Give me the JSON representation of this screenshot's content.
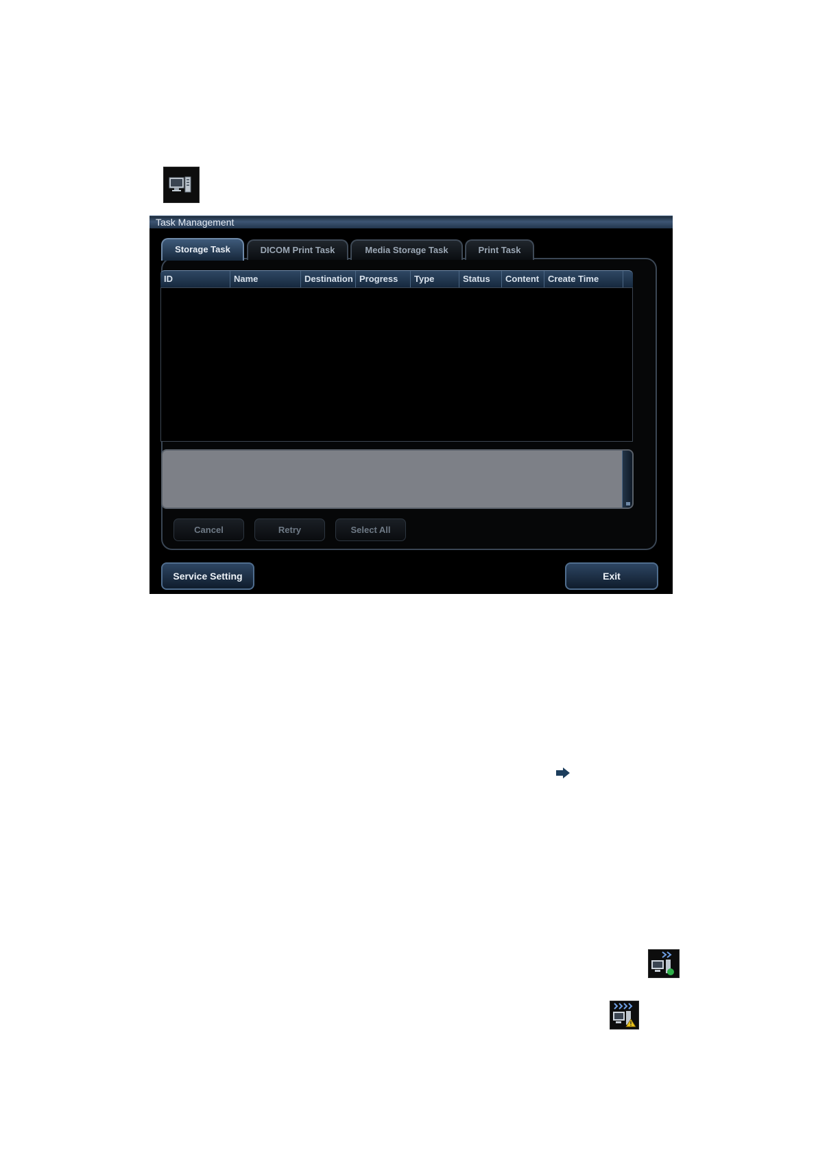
{
  "header_icon": {
    "name": "monitor-server-icon"
  },
  "window": {
    "title": "Task Management",
    "tabs": [
      {
        "label": "Storage Task",
        "active": true
      },
      {
        "label": "DICOM Print Task",
        "active": false
      },
      {
        "label": "Media Storage Task",
        "active": false
      },
      {
        "label": "Print Task",
        "active": false
      }
    ],
    "table": {
      "columns": [
        "ID",
        "Name",
        "Destination",
        "Progress",
        "Type",
        "Status",
        "Content",
        "Create Time"
      ],
      "rows": []
    },
    "message_box": {
      "value": ""
    },
    "buttons": {
      "cancel": "Cancel",
      "retry": "Retry",
      "select_all": "Select All",
      "service_setting": "Service Setting",
      "exit": "Exit"
    }
  },
  "arrow_marker": {
    "name": "right-arrow-icon",
    "color": "#1c3d5c"
  },
  "status_icons": [
    {
      "name": "network-sending-icon"
    },
    {
      "name": "network-warning-icon"
    }
  ],
  "colors": {
    "accent_blue": "#3e5a7a",
    "panel_border": "#3a4654",
    "message_box": "#7d8087"
  }
}
